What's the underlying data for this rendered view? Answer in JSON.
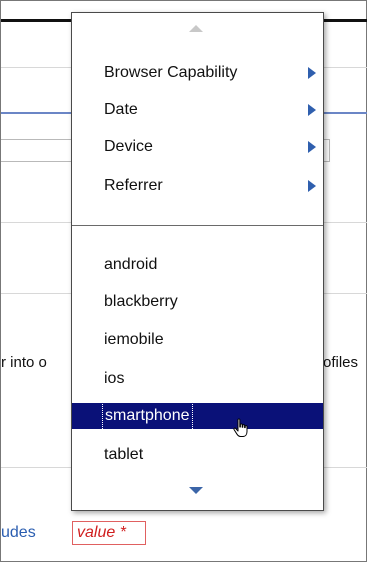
{
  "background": {
    "left_text": "r into o",
    "right_text": "ofiles",
    "bottom_link": "udes",
    "value_field": "value *"
  },
  "menu": {
    "submenus": [
      {
        "label": "Browser Capability",
        "icon": "chevron-right-icon"
      },
      {
        "label": "Date",
        "icon": "chevron-right-icon"
      },
      {
        "label": "Device",
        "icon": "chevron-right-icon"
      },
      {
        "label": "Referrer",
        "icon": "chevron-right-icon"
      }
    ],
    "options": [
      "android",
      "blackberry",
      "iemobile",
      "ios",
      "smartphone",
      "tablet"
    ],
    "selected": "smartphone"
  },
  "colors": {
    "selection": "#0a1178",
    "arrow": "#2f5fae",
    "required": "#d01f1f"
  }
}
